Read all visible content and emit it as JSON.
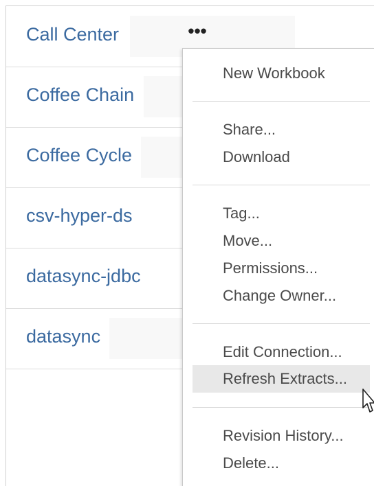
{
  "list": {
    "rows": [
      {
        "name": "Call Center"
      },
      {
        "name": "Coffee Chain"
      },
      {
        "name": "Coffee Cycle"
      },
      {
        "name": "csv-hyper-ds"
      },
      {
        "name": "datasync-jdbc"
      },
      {
        "name": "datasync"
      }
    ],
    "more_button": "•••"
  },
  "context_menu": {
    "groups": [
      [
        {
          "label": "New Workbook"
        }
      ],
      [
        {
          "label": "Share..."
        },
        {
          "label": "Download"
        }
      ],
      [
        {
          "label": "Tag..."
        },
        {
          "label": "Move..."
        },
        {
          "label": "Permissions..."
        },
        {
          "label": "Change Owner..."
        }
      ],
      [
        {
          "label": "Edit Connection..."
        },
        {
          "label": "Refresh Extracts..."
        }
      ],
      [
        {
          "label": "Revision History..."
        },
        {
          "label": "Delete..."
        }
      ]
    ],
    "highlighted_item": "Refresh Extracts..."
  },
  "colors": {
    "link": "#3b6aa0",
    "menu_text": "#4a4a4a",
    "highlight": "#e8e8e8"
  }
}
